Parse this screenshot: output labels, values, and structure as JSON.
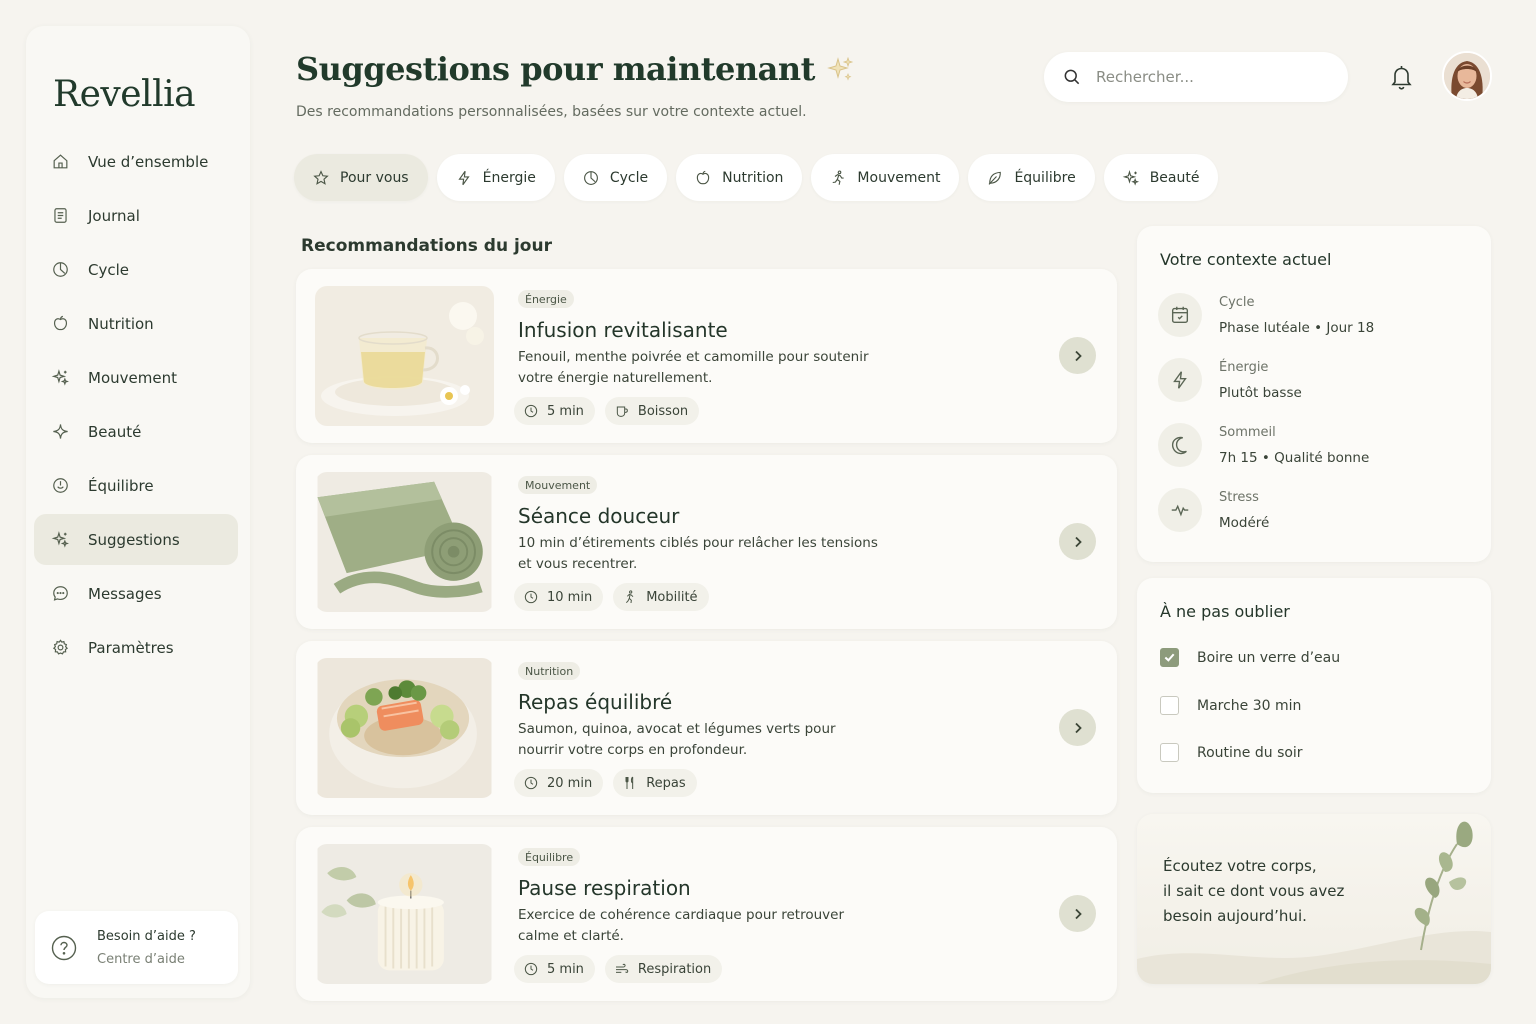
{
  "app": {
    "name": "Revellia"
  },
  "header": {
    "title": "Suggestions pour maintenant",
    "subtitle": "Des recommandations personnalisées, basées sur votre contexte actuel.",
    "search_placeholder": "Rechercher..."
  },
  "sidebar": {
    "items": [
      {
        "label": "Vue d’ensemble",
        "icon": "home-icon"
      },
      {
        "label": "Journal",
        "icon": "journal-icon"
      },
      {
        "label": "Cycle",
        "icon": "cycle-icon"
      },
      {
        "label": "Nutrition",
        "icon": "apple-icon"
      },
      {
        "label": "Mouvement",
        "icon": "sparkles-icon"
      },
      {
        "label": "Beauté",
        "icon": "sparkle-icon"
      },
      {
        "label": "Équilibre",
        "icon": "balance-icon"
      },
      {
        "label": "Suggestions",
        "icon": "sparkles-icon",
        "active": true
      },
      {
        "label": "Messages",
        "icon": "chat-icon"
      },
      {
        "label": "Paramètres",
        "icon": "gear-icon"
      }
    ],
    "help": {
      "title": "Besoin d’aide ?",
      "subtitle": "Centre d’aide"
    }
  },
  "filters": [
    {
      "label": "Pour vous",
      "icon": "star-icon",
      "active": true
    },
    {
      "label": "Énergie",
      "icon": "bolt-icon"
    },
    {
      "label": "Cycle",
      "icon": "cycle-icon"
    },
    {
      "label": "Nutrition",
      "icon": "apple-icon"
    },
    {
      "label": "Mouvement",
      "icon": "runner-icon"
    },
    {
      "label": "Équilibre",
      "icon": "leaf-icon"
    },
    {
      "label": "Beauté",
      "icon": "sparkles-icon"
    }
  ],
  "recommendations": {
    "title": "Recommandations du jour",
    "items": [
      {
        "tag": "Énergie",
        "title": "Infusion revitalisante",
        "desc": "Fenouil, menthe poivrée et camomille pour soutenir votre énergie naturellement.",
        "duration": "5 min",
        "type": "Boisson",
        "type_icon": "cup-icon"
      },
      {
        "tag": "Mouvement",
        "title": "Séance douceur",
        "desc": "10 min d’étirements ciblés pour relâcher les tensions et vous recentrer.",
        "duration": "10 min",
        "type": "Mobilité",
        "type_icon": "runner-icon"
      },
      {
        "tag": "Nutrition",
        "title": "Repas équilibré",
        "desc": "Saumon, quinoa, avocat et légumes verts pour nourrir votre corps en profondeur.",
        "duration": "20 min",
        "type": "Repas",
        "type_icon": "fork-icon"
      },
      {
        "tag": "Équilibre",
        "title": "Pause respiration",
        "desc": "Exercice de cohérence cardiaque pour retrouver calme et clarté.",
        "duration": "5 min",
        "type": "Respiration",
        "type_icon": "wind-icon"
      }
    ]
  },
  "context": {
    "title": "Votre contexte actuel",
    "items": [
      {
        "label": "Cycle",
        "value": "Phase lutéale • Jour 18",
        "icon": "calendar-icon"
      },
      {
        "label": "Énergie",
        "value": "Plutôt basse",
        "icon": "bolt-icon"
      },
      {
        "label": "Sommeil",
        "value": "7h 15 • Qualité bonne",
        "icon": "moon-icon"
      },
      {
        "label": "Stress",
        "value": "Modéré",
        "icon": "pulse-icon"
      }
    ]
  },
  "todo": {
    "title": "À ne pas oublier",
    "items": [
      {
        "label": "Boire un verre d’eau",
        "checked": true
      },
      {
        "label": "Marche 30 min",
        "checked": false
      },
      {
        "label": "Routine du soir",
        "checked": false
      }
    ]
  },
  "quote": {
    "line1": "Écoutez votre corps,",
    "line2": "il sait ce dont vous avez",
    "line3": "besoin aujourd’hui."
  },
  "colors": {
    "accent": "#8d9b7c",
    "active_bg": "#ebeae0",
    "background": "#f6f4ef",
    "title": "#213a2b"
  }
}
